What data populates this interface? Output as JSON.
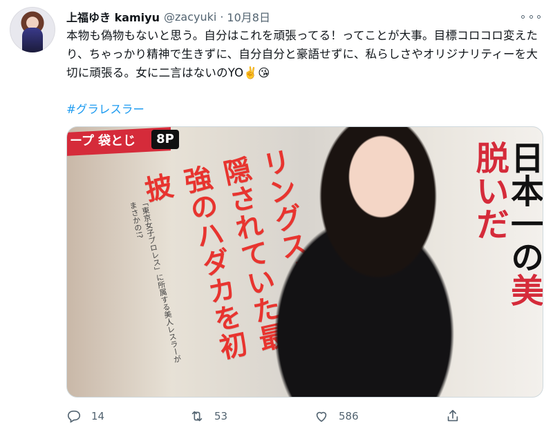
{
  "tweet": {
    "display_name": "上福ゆき kamiyu",
    "handle": "@zacyuki",
    "date": "10月8日",
    "text": "本物も偽物もないと思う。自分はこれを頑張ってる！ってことが大事。目標コロコロ変えたり、ちゃっかり精神で生きずに、自分自分と豪語せずに、私らしさやオリジナリティーを大切に頑張る。女に二言はないのYO✌️😘",
    "hashtag": "#グラレスラー",
    "media": {
      "mag_label": "ープ 袋とじ",
      "mag_page": "8P",
      "headline": "リングスーツで隠されていた最強のハダカを初披",
      "small_note": "「東京女子プロレス」に所属する美人レスラーがまさかの!?",
      "right_text_black": "日本一の",
      "right_text_red": "美",
      "right_text_black2": "脱いだ"
    },
    "actions": {
      "reply_count": "14",
      "retweet_count": "53",
      "like_count": "586"
    }
  },
  "icons": {
    "more": "more-icon",
    "reply": "reply-icon",
    "retweet": "retweet-icon",
    "like": "heart-icon",
    "share": "share-icon"
  }
}
